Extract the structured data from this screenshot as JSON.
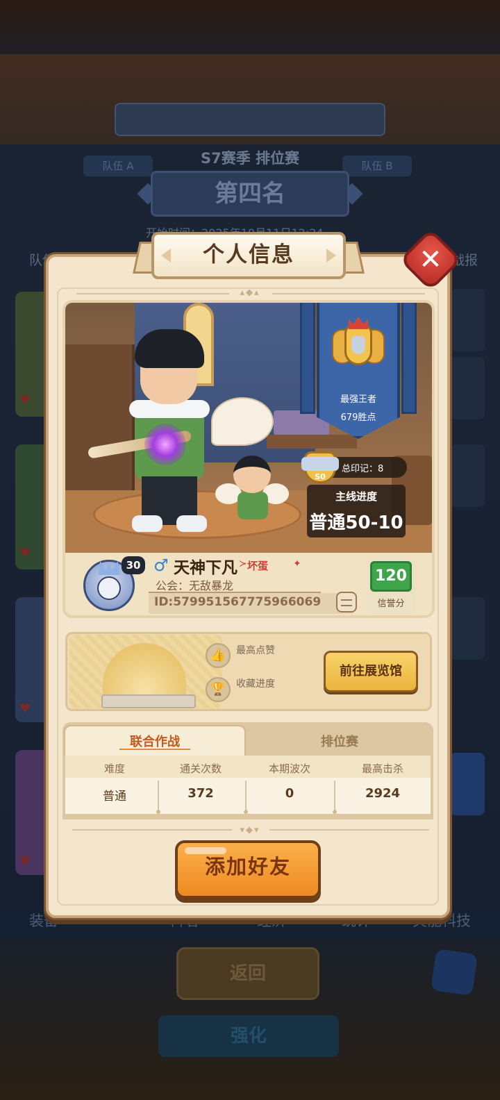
{
  "background": {
    "season_title": "S7赛季 排位赛",
    "team_a": "队伍 A",
    "team_b": "队伍 B",
    "rank_result": "第四名",
    "start_time": "开始时间：2025年10月11日12:24",
    "tab_left": "队伍",
    "tab_right": "战报",
    "bottom_tabs": [
      "装备",
      "阵容",
      "经济",
      "统计",
      "灾能科技"
    ],
    "return_button": "返回",
    "strengthen_button": "强化"
  },
  "dialog": {
    "title": "个人信息",
    "close_icon": "close-x-icon"
  },
  "hero": {
    "rank_title": "最强王者",
    "rank_points": "679胜点",
    "mark_badge": "S0",
    "total_marks": "总印记：8",
    "mainline_title": "主线进度",
    "mainline_value": "普通50-10"
  },
  "profile": {
    "level": "30",
    "gender_symbol": "♂",
    "name": "天神下凡",
    "tag": "坏蛋",
    "guild": "公会：无敌暴龙",
    "id": "ID:579951567775966069",
    "credit_value": "120",
    "credit_label": "信誉分"
  },
  "exhibition": {
    "likes_label": "最高点赞",
    "collection_label": "收藏进度",
    "gallery_button": "前往展览馆"
  },
  "stats": {
    "tabs": [
      "联合作战",
      "排位赛"
    ],
    "active_tab": "联合作战",
    "columns": [
      "难度",
      "通关次数",
      "本期波次",
      "最高击杀"
    ],
    "row": [
      "普通",
      "372",
      "0",
      "2924"
    ]
  },
  "actions": {
    "add_friend": "添加好友"
  },
  "colors": {
    "panel_bg": "#f3e6cc",
    "accent_orange": "#ef8a24",
    "close_red": "#c8342c",
    "credit_green": "#3ea54a",
    "banner_blue": "#3d66a8"
  }
}
